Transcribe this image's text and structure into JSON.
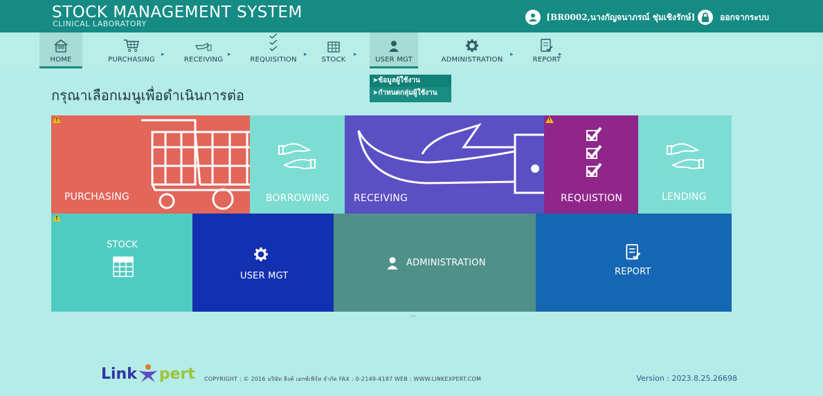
{
  "header": {
    "title": "STOCK MANAGEMENT SYSTEM",
    "subtitle": "CLINICAL LABORATORY",
    "user": "[BR0002,นางกัญจนาภรณ์ ชุ่มเชิงรักษ์]",
    "logout": "ออกจากระบบ"
  },
  "nav": {
    "items": [
      {
        "label": "HOME",
        "icon": "home-icon"
      },
      {
        "label": "PURCHASING",
        "icon": "cart-icon"
      },
      {
        "label": "RECEIVING",
        "icon": "hand-receive-icon"
      },
      {
        "label": "REQUISITION",
        "icon": "checklist-icon"
      },
      {
        "label": "STOCK",
        "icon": "grid-icon"
      },
      {
        "label": "USER MGT",
        "icon": "user-icon"
      },
      {
        "label": "ADMINISTRATION",
        "icon": "gear-icon"
      },
      {
        "label": "REPORT",
        "icon": "report-icon"
      }
    ]
  },
  "dropdown": {
    "items": [
      "➤ข้อมูลผู้ใช้งาน",
      "➤กำหนดกลุ่มผู้ใช้งาน"
    ]
  },
  "prompt": "กรุณาเลือกเมนูเพื่อดำเนินการต่อ",
  "tiles": {
    "purchasing": "PURCHASING",
    "borrowing": "BORROWING",
    "receiving": "RECEIVING",
    "requisition": "REQUISTION",
    "lending": "LENDING",
    "stock": "STOCK",
    "user_mgt": "USER MGT",
    "administration": "ADMINISTRATION",
    "report": "REPORT"
  },
  "colors": {
    "header": "#158b84",
    "purchasing": "#e2665a",
    "borrowing": "#7dddd3",
    "receiving": "#5b4fc4",
    "requisition": "#90268a",
    "stock": "#50cbc2",
    "user_mgt": "#1330b0",
    "administration": "#4f9189",
    "report": "#1566b3"
  },
  "footer": {
    "logo": "Linkxpert",
    "copyright": "COPYRIGHT : © 2016 บริษัท ลิงค์ เอกซ์เพิร์ท จำกัด  FAX : 0-2149-4187  WEB : WWW.LINKEXPERT.COM",
    "version": "Version : 2023.8.25.26698"
  }
}
